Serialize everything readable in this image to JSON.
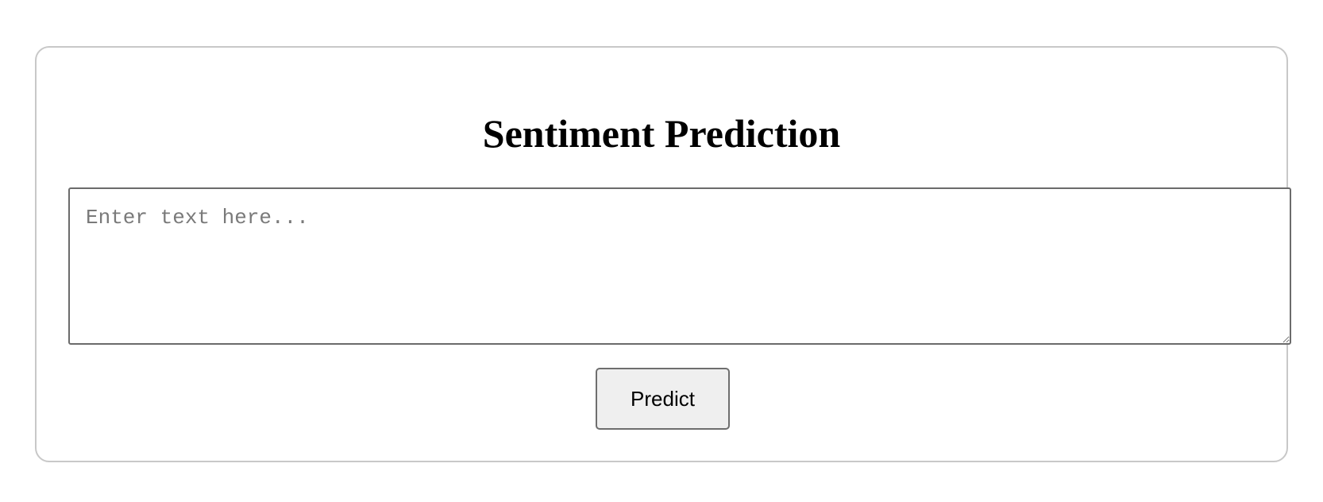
{
  "page": {
    "title": "Sentiment Prediction"
  },
  "form": {
    "text_input": {
      "value": "",
      "placeholder": "Enter text here..."
    },
    "predict_label": "Predict"
  },
  "colors": {
    "card_border": "#c8c8c8",
    "input_border": "#6b6b6b",
    "button_background": "#efefef",
    "placeholder": "#7a7a7a"
  }
}
